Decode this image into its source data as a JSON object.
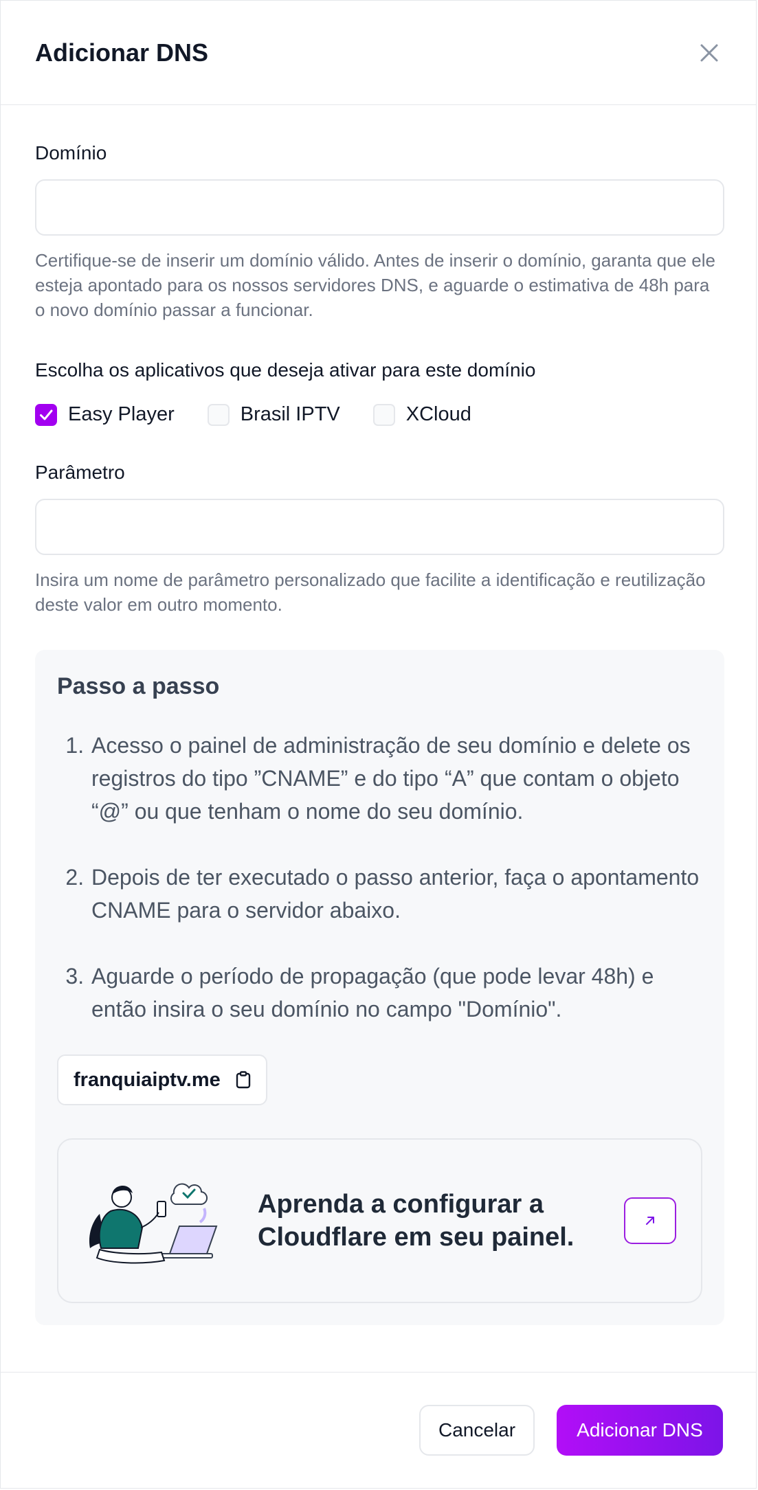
{
  "header": {
    "title": "Adicionar DNS"
  },
  "form": {
    "domain_label": "Domínio",
    "domain_value": "",
    "domain_help": "Certifique-se de inserir um domínio válido. Antes de inserir o domínio, garanta que ele esteja apontado para os nossos servidores DNS, e aguarde o estimativa de 48h para o novo domínio passar a funcionar.",
    "apps_label": "Escolha os aplicativos que deseja ativar para este domínio",
    "apps": [
      {
        "label": "Easy Player",
        "checked": true
      },
      {
        "label": "Brasil IPTV",
        "checked": false
      },
      {
        "label": "XCloud",
        "checked": false
      }
    ],
    "param_label": "Parâmetro",
    "param_value": "",
    "param_help": "Insira um nome de parâmetro personalizado que facilite a identificação e reutilização deste valor em outro momento."
  },
  "steps": {
    "title": "Passo a passo",
    "items": [
      "Acesso o painel de administração de seu domínio e delete os registros do tipo ”CNAME” e do tipo “A” que contam o objeto “@” ou que tenham o nome do seu domínio.",
      "Depois de ter executado o passo anterior, faça o apontamento CNAME para o servidor abaixo.",
      "Aguarde o período de propagação (que pode levar 48h) e então insira o seu domínio no campo \"Domínio\"."
    ],
    "server": "franquiaiptv.me",
    "cloudflare_text": "Aprenda a configurar a Cloudflare em seu painel."
  },
  "footer": {
    "cancel_label": "Cancelar",
    "submit_label": "Adicionar DNS"
  },
  "colors": {
    "accent": "#a200f0",
    "accent_end": "#7c14e8"
  },
  "icons": {
    "close": "close-icon",
    "checkmark": "check-icon",
    "copy": "clipboard-icon",
    "external": "arrow-up-right-icon"
  }
}
